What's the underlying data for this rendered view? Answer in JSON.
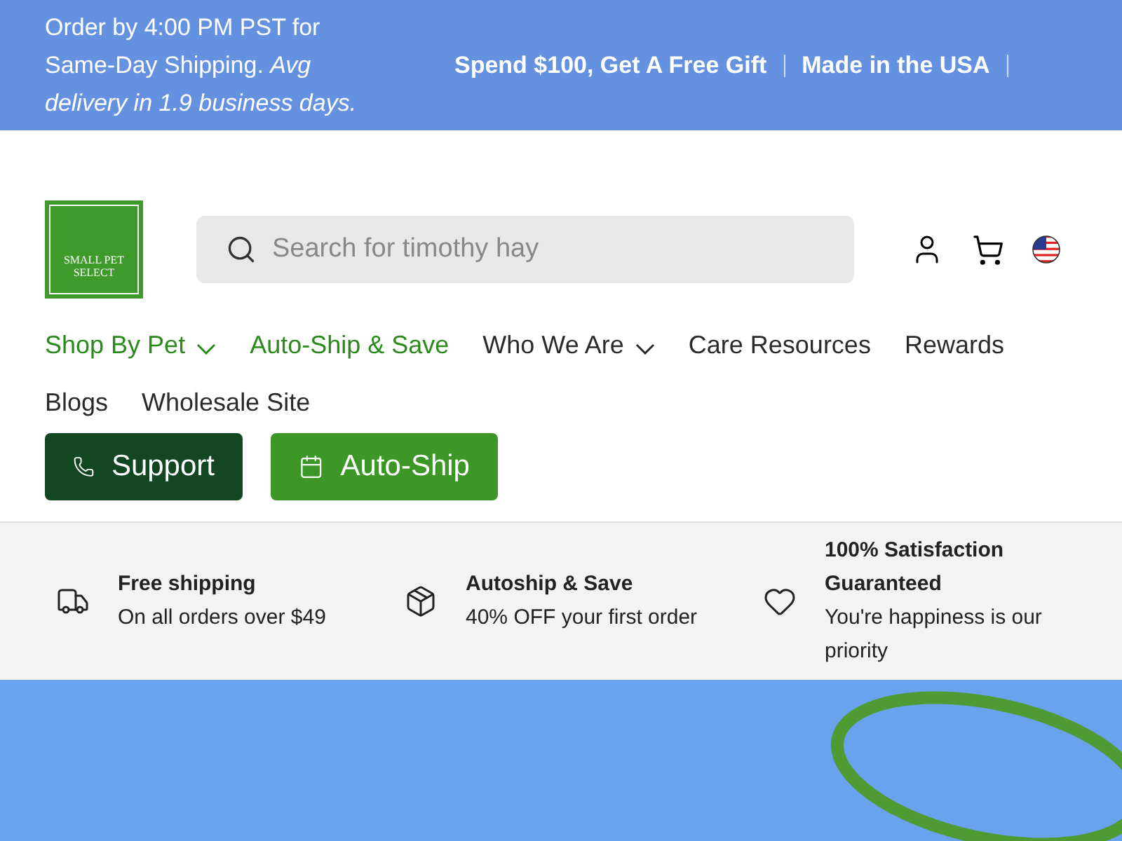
{
  "announcement": {
    "text": "Order by 4:00 PM PST for Same-Day Shipping. *Avg delivery in 1.9 business days.*",
    "links": [
      "Spend $100, Get A Free Gift",
      "Made in the USA"
    ]
  },
  "header": {
    "logo": {
      "line_1": "SMALL PET",
      "line_2": "SELECT"
    },
    "search": {
      "placeholder": "Search for timothy hay"
    }
  },
  "nav": [
    {
      "label": "Shop By Pet",
      "highlighted": true,
      "dropdown": true
    },
    {
      "label": "Auto-Ship & Save",
      "highlighted": true,
      "dropdown": false
    },
    {
      "label": "Who We Are",
      "highlighted": false,
      "dropdown": true
    },
    {
      "label": "Care Resources",
      "highlighted": false,
      "dropdown": false
    },
    {
      "label": "Rewards",
      "highlighted": false,
      "dropdown": false
    },
    {
      "label": "Blogs",
      "highlighted": false,
      "dropdown": false
    },
    {
      "label": "Wholesale Site",
      "highlighted": false,
      "dropdown": false
    }
  ],
  "action_buttons": [
    {
      "label": "Support",
      "kind": "phone"
    },
    {
      "label": "Auto-Ship",
      "kind": "calendar"
    }
  ],
  "benefits": [
    {
      "kind": "truck",
      "title": "Free shipping",
      "text": "On all orders over $49"
    },
    {
      "kind": "box",
      "title": "Autoship & Save",
      "text": "40% OFF your first order"
    },
    {
      "kind": "heart",
      "title": "100% Satisfaction Guaranteed",
      "text": "You're happiness is our priority"
    }
  ]
}
